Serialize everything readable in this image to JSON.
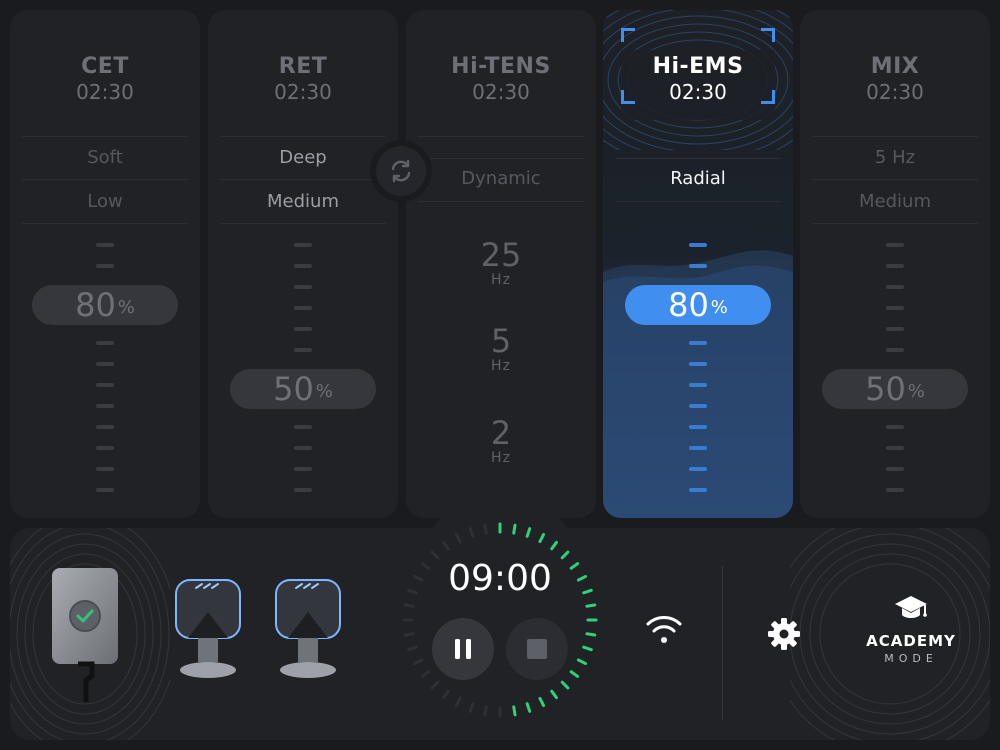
{
  "colors": {
    "accent": "#3f8ef0",
    "progress": "#2fd17a",
    "ok": "#33c47a"
  },
  "modes": [
    {
      "title": "CET",
      "time": "02:30",
      "options": [
        "Soft",
        "Low"
      ],
      "intensity": "80",
      "unit": "%"
    },
    {
      "title": "RET",
      "time": "02:30",
      "options": [
        "Deep",
        "Medium"
      ],
      "intensity": "50",
      "unit": "%"
    },
    {
      "title": "Hi-TENS",
      "time": "02:30",
      "options": [
        "Dynamic"
      ],
      "frequencies": [
        {
          "value": "25",
          "unit": "Hz"
        },
        {
          "value": "5",
          "unit": "Hz"
        },
        {
          "value": "2",
          "unit": "Hz"
        }
      ]
    },
    {
      "title": "Hi-EMS",
      "time": "02:30",
      "options": [
        "Radial"
      ],
      "intensity": "80",
      "unit": "%",
      "selected": true
    },
    {
      "title": "MIX",
      "time": "02:30",
      "options": [
        "5 Hz",
        "Medium"
      ],
      "intensity": "50",
      "unit": "%"
    }
  ],
  "swap_icon": "swap-arrows-icon",
  "bottom": {
    "timer": "09:00",
    "timer_progress": 0.5,
    "pause_icon": "pause-icon",
    "stop_icon": "stop-icon",
    "wifi_icon": "wifi-icon",
    "settings_icon": "gear-icon",
    "academy": {
      "icon": "graduation-cap-icon",
      "title": "ACADEMY",
      "subtitle": "MODE"
    }
  }
}
